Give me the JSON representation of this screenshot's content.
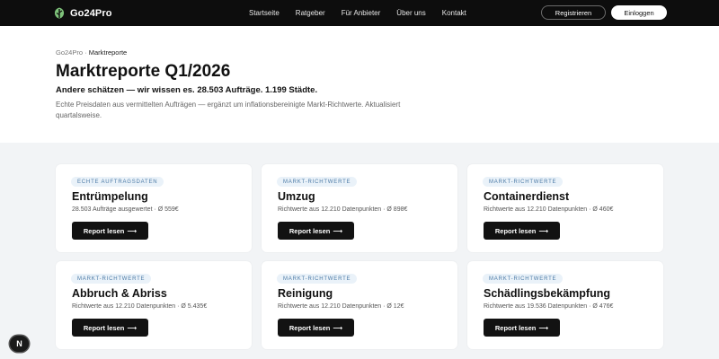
{
  "brand": {
    "name": "Go24Pro",
    "accent": "#7ec27a"
  },
  "nav": {
    "links": [
      "Startseite",
      "Ratgeber",
      "Für Anbieter",
      "Über uns",
      "Kontakt"
    ],
    "register_label": "Registrieren",
    "login_label": "Einloggen"
  },
  "hero": {
    "breadcrumb_root": "Go24Pro",
    "breadcrumb_sep": "·",
    "breadcrumb_current": "Marktreporte",
    "title": "Marktreporte Q1/2026",
    "subtitle": "Andere schätzen — wir wissen es. 28.503 Aufträge. 1.199 Städte.",
    "description": "Echte Preisdaten aus vermittelten Aufträgen — ergänzt um inflationsbereinigte Markt-Richtwerte. Aktualisiert quartalsweise."
  },
  "cards": [
    {
      "badge": "ECHTE AUFTRAGSDATEN",
      "title": "Entrümpelung",
      "meta": "28.503 Aufträge ausgewertet · Ø 559€",
      "button": "Report lesen",
      "arrow": "⟶"
    },
    {
      "badge": "MARKT-RICHTWERTE",
      "title": "Umzug",
      "meta": "Richtwerte aus 12.210 Datenpunkten · Ø 898€",
      "button": "Report lesen",
      "arrow": "⟶"
    },
    {
      "badge": "MARKT-RICHTWERTE",
      "title": "Containerdienst",
      "meta": "Richtwerte aus 12.210 Datenpunkten · Ø 460€",
      "button": "Report lesen",
      "arrow": "⟶"
    },
    {
      "badge": "MARKT-RICHTWERTE",
      "title": "Abbruch & Abriss",
      "meta": "Richtwerte aus 12.210 Datenpunkten · Ø 5.435€",
      "button": "Report lesen",
      "arrow": "⟶"
    },
    {
      "badge": "MARKT-RICHTWERTE",
      "title": "Reinigung",
      "meta": "Richtwerte aus 12.210 Datenpunkten · Ø 12€",
      "button": "Report lesen",
      "arrow": "⟶"
    },
    {
      "badge": "MARKT-RICHTWERTE",
      "title": "Schädlingsbekämpfung",
      "meta": "Richtwerte aus 19.536 Datenpunkten · Ø 476€",
      "button": "Report lesen",
      "arrow": "⟶"
    }
  ],
  "floating_badge": {
    "label": "N"
  },
  "icons": {
    "logo": "leaf-icon",
    "arrow": "arrow-right-icon"
  }
}
